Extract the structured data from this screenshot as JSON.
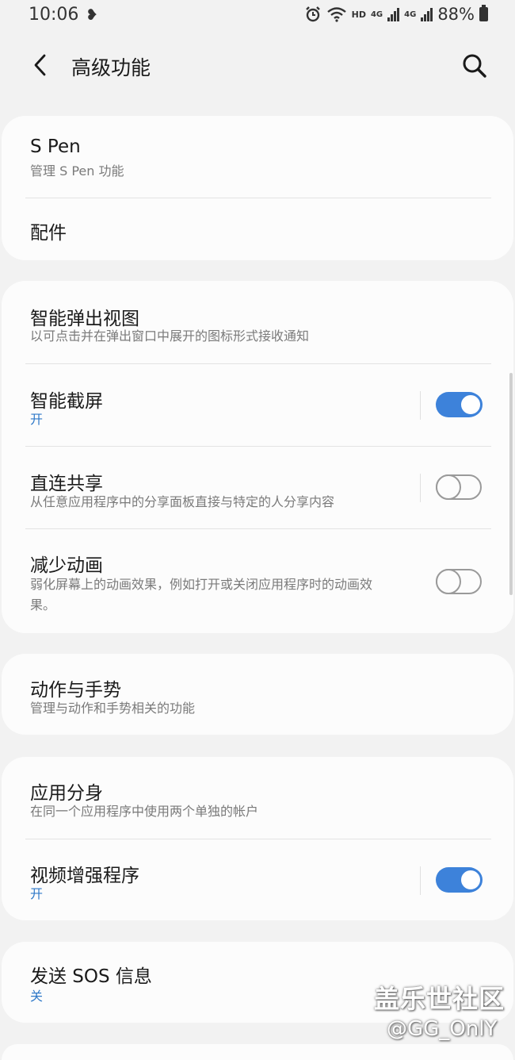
{
  "status_bar": {
    "time": "10:06",
    "network_hd": "HD",
    "network_4g_1": "4G",
    "network_4g_2": "4G",
    "battery": "88%"
  },
  "header": {
    "title": "高级功能"
  },
  "colors": {
    "accent": "#3d82da",
    "background": "#f2f2f2",
    "card": "#fcfcfc"
  },
  "groups": [
    {
      "items": [
        {
          "title": "S Pen",
          "subtitle": "管理 S Pen 功能"
        },
        {
          "title": "配件"
        }
      ]
    },
    {
      "items": [
        {
          "title": "智能弹出视图",
          "subtitle": "以可点击并在弹出窗口中展开的图标形式接收通知"
        },
        {
          "title": "智能截屏",
          "status": "开",
          "toggle": true
        },
        {
          "title": "直连共享",
          "subtitle": "从任意应用程序中的分享面板直接与特定的人分享内容",
          "toggle": false
        },
        {
          "title": "减少动画",
          "subtitle_line1": "弱化屏幕上的动画效果，例如打开或关闭应用程序时的动画效",
          "subtitle_line2": "果。",
          "toggle": false
        }
      ]
    },
    {
      "items": [
        {
          "title": "动作与手势",
          "subtitle": "管理与动作和手势相关的功能"
        }
      ]
    },
    {
      "items": [
        {
          "title": "应用分身",
          "subtitle": "在同一个应用程序中使用两个单独的帐户"
        },
        {
          "title": "视频增强程序",
          "status": "开",
          "toggle": true
        }
      ]
    },
    {
      "items": [
        {
          "title": "发送 SOS 信息",
          "status": "关"
        }
      ]
    }
  ],
  "watermark": {
    "line1": "盖乐世社区",
    "line2": "@GG_OnlY"
  }
}
